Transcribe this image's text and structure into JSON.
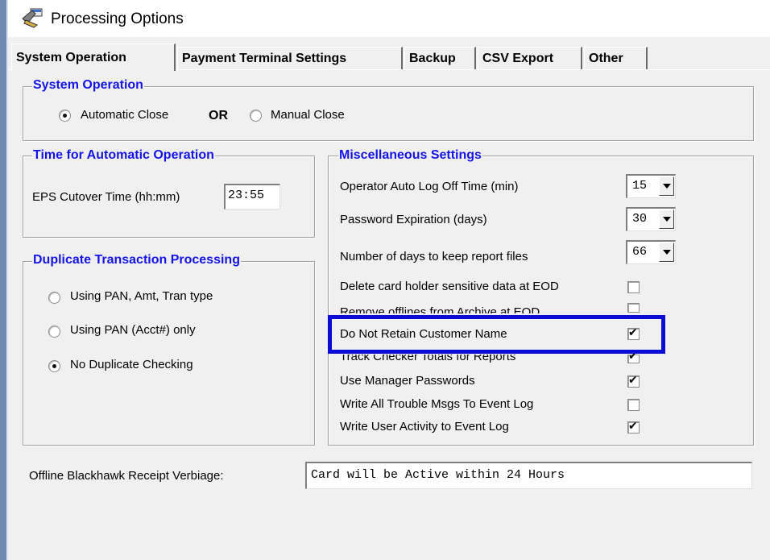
{
  "window": {
    "title": "Processing Options",
    "icon": "app-icon"
  },
  "tabs": [
    {
      "label": "System Operation",
      "active": true
    },
    {
      "label": "Payment Terminal Settings",
      "active": false
    },
    {
      "label": "Backup",
      "active": false
    },
    {
      "label": "CSV Export",
      "active": false
    },
    {
      "label": "Other",
      "active": false
    }
  ],
  "system_operation": {
    "title": "System Operation",
    "auto_close_label": "Automatic Close",
    "or_label": "OR",
    "manual_close_label": "Manual Close",
    "selected": "Automatic Close"
  },
  "auto_operation": {
    "title": "Time for Automatic Operation",
    "cutover_label": "EPS Cutover Time (hh:mm)",
    "cutover_value": "23:55"
  },
  "duplicate": {
    "title": "Duplicate Transaction Processing",
    "options": [
      "Using PAN, Amt, Tran type",
      "Using PAN (Acct#) only",
      "No Duplicate Checking"
    ],
    "selected": "No Duplicate Checking"
  },
  "misc": {
    "title": "Miscellaneous Settings",
    "dropdowns": [
      {
        "label": "Operator Auto Log Off Time (min)",
        "value": "15"
      },
      {
        "label": "Password Expiration (days)",
        "value": "30"
      },
      {
        "label": "Number of days to keep report files",
        "value": "66"
      }
    ],
    "checkboxes": [
      {
        "label": "Delete card holder sensitive data at EOD",
        "checked": false
      },
      {
        "label": "Remove offlines from Archive at EOD",
        "checked": false
      },
      {
        "label": "Do Not Retain Customer Name",
        "checked": true
      },
      {
        "label": "Track Checker Totals for Reports",
        "checked": true
      },
      {
        "label": "Use Manager Passwords",
        "checked": true
      },
      {
        "label": "Write All Trouble Msgs To Event Log",
        "checked": false
      },
      {
        "label": "Write User Activity to Event Log",
        "checked": true
      }
    ],
    "check_mark": "✔"
  },
  "receipt": {
    "label": "Offline Blackhawk Receipt Verbiage:",
    "value": "Card will be Active within 24 Hours"
  },
  "colors": {
    "group_title": "#1414e6",
    "highlight": "#0b0bd6"
  }
}
